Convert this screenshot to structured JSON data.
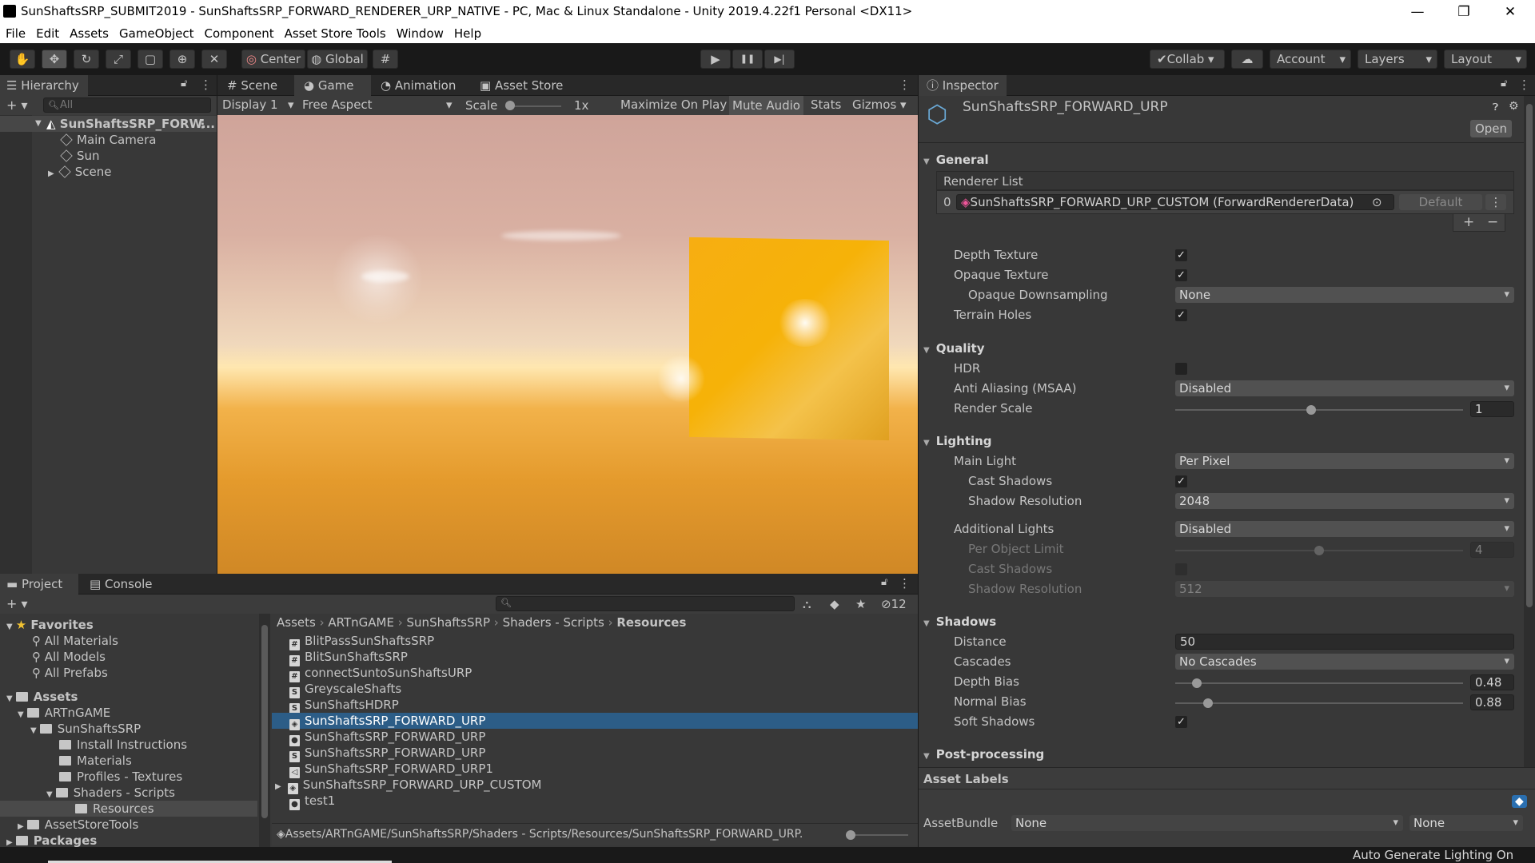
{
  "window": {
    "title": "SunShaftsSRP_SUBMIT2019 - SunShaftsSRP_FORWARD_RENDERER_URP_NATIVE - PC, Mac & Linux Standalone - Unity 2019.4.22f1 Personal <DX11>",
    "minimize": "—",
    "maximize": "❐",
    "close": "✕"
  },
  "menu": [
    "File",
    "Edit",
    "Assets",
    "GameObject",
    "Component",
    "Asset Store Tools",
    "Window",
    "Help"
  ],
  "toolbar": {
    "pivot": "Center",
    "space": "Global",
    "play": "▶",
    "pause": "❚❚",
    "step": "▶|",
    "collab": "Collab",
    "account": "Account",
    "layers": "Layers",
    "layout": "Layout"
  },
  "hierarchy": {
    "tab": "Hierarchy",
    "search_placeholder": "All",
    "scene_name": "SunShaftsSRP_FORW...",
    "items": [
      "Main Camera",
      "Sun",
      "Scene"
    ]
  },
  "game_view": {
    "tabs": [
      "Scene",
      "Game",
      "Animation",
      "Asset Store"
    ],
    "display": "Display 1",
    "aspect": "Free Aspect",
    "scale_label": "Scale",
    "scale_value": "1x",
    "maximize_on_play": "Maximize On Play",
    "mute_audio": "Mute Audio",
    "stats": "Stats",
    "gizmos": "Gizmos"
  },
  "project": {
    "tabs": [
      "Project",
      "Console"
    ],
    "hidden_count": "12",
    "favorites_label": "Favorites",
    "favorites": [
      "All Materials",
      "All Models",
      "All Prefabs"
    ],
    "assets_label": "Assets",
    "tree": [
      {
        "label": "ARTnGAME",
        "level": 1
      },
      {
        "label": "SunShaftsSRP",
        "level": 2
      },
      {
        "label": "Install Instructions",
        "level": 3
      },
      {
        "label": "Materials",
        "level": 3
      },
      {
        "label": "Profiles - Textures",
        "level": 3
      },
      {
        "label": "Shaders - Scripts",
        "level": 3
      },
      {
        "label": "Resources",
        "level": 4
      },
      {
        "label": "AssetStoreTools",
        "level": 1
      },
      {
        "label": "Packages",
        "level": 0
      }
    ],
    "breadcrumb": [
      "Assets",
      "ARTnGAME",
      "SunShaftsSRP",
      "Shaders - Scripts",
      "Resources"
    ],
    "files": [
      {
        "name": "BlitPassSunShaftsSRP",
        "icon": "#"
      },
      {
        "name": "BlitSunShaftsSRP",
        "icon": "#"
      },
      {
        "name": "connectSuntoSunShaftsURP",
        "icon": "#"
      },
      {
        "name": "GreyscaleShafts",
        "icon": "S"
      },
      {
        "name": "SunShaftsHDRP",
        "icon": "S"
      },
      {
        "name": "SunShaftsSRP_FORWARD_URP",
        "icon": "◈",
        "selected": true
      },
      {
        "name": "SunShaftsSRP_FORWARD_URP",
        "icon": "●"
      },
      {
        "name": "SunShaftsSRP_FORWARD_URP",
        "icon": "S"
      },
      {
        "name": "SunShaftsSRP_FORWARD_URP1",
        "icon": "◁"
      },
      {
        "name": "SunShaftsSRP_FORWARD_URP_CUSTOM",
        "icon": "◈"
      },
      {
        "name": "test1",
        "icon": "●"
      }
    ],
    "status_path": "Assets/ARTnGAME/SunShaftsSRP/Shaders - Scripts/Resources/SunShaftsSRP_FORWARD_URP."
  },
  "inspector": {
    "tab": "Inspector",
    "asset_name": "SunShaftsSRP_FORWARD_URP",
    "open_button": "Open",
    "general": "General",
    "renderer_list": "Renderer List",
    "renderer_index": "0",
    "renderer_value": "SunShaftsSRP_FORWARD_URP_CUSTOM (ForwardRendererData)",
    "renderer_default": "Default",
    "depth_texture": "Depth Texture",
    "opaque_texture": "Opaque Texture",
    "opaque_downsampling": "Opaque Downsampling",
    "opaque_downsampling_value": "None",
    "terrain_holes": "Terrain Holes",
    "quality": "Quality",
    "hdr": "HDR",
    "msaa": "Anti Aliasing (MSAA)",
    "msaa_value": "Disabled",
    "render_scale": "Render Scale",
    "render_scale_value": "1",
    "lighting": "Lighting",
    "main_light": "Main Light",
    "main_light_value": "Per Pixel",
    "cast_shadows": "Cast Shadows",
    "shadow_resolution": "Shadow Resolution",
    "shadow_resolution_value": "2048",
    "additional_lights": "Additional Lights",
    "additional_lights_value": "Disabled",
    "per_object_limit": "Per Object Limit",
    "per_object_limit_value": "4",
    "add_cast_shadows": "Cast Shadows",
    "add_shadow_resolution": "Shadow Resolution",
    "add_shadow_resolution_value": "512",
    "shadows": "Shadows",
    "distance": "Distance",
    "distance_value": "50",
    "cascades": "Cascades",
    "cascades_value": "No Cascades",
    "depth_bias": "Depth Bias",
    "depth_bias_value": "0.48",
    "normal_bias": "Normal Bias",
    "normal_bias_value": "0.88",
    "soft_shadows": "Soft Shadows",
    "post_processing": "Post-processing",
    "asset_labels": "Asset Labels",
    "asset_bundle": "AssetBundle",
    "asset_bundle_value": "None",
    "asset_variant_value": "None",
    "checkmark": "✓",
    "slider_levels": {
      "render_scale": 0.47,
      "per_object_limit": 0.5,
      "depth_bias": 0.06,
      "normal_bias": 0.1
    }
  },
  "statusbar": {
    "text": "Auto Generate Lighting On"
  }
}
